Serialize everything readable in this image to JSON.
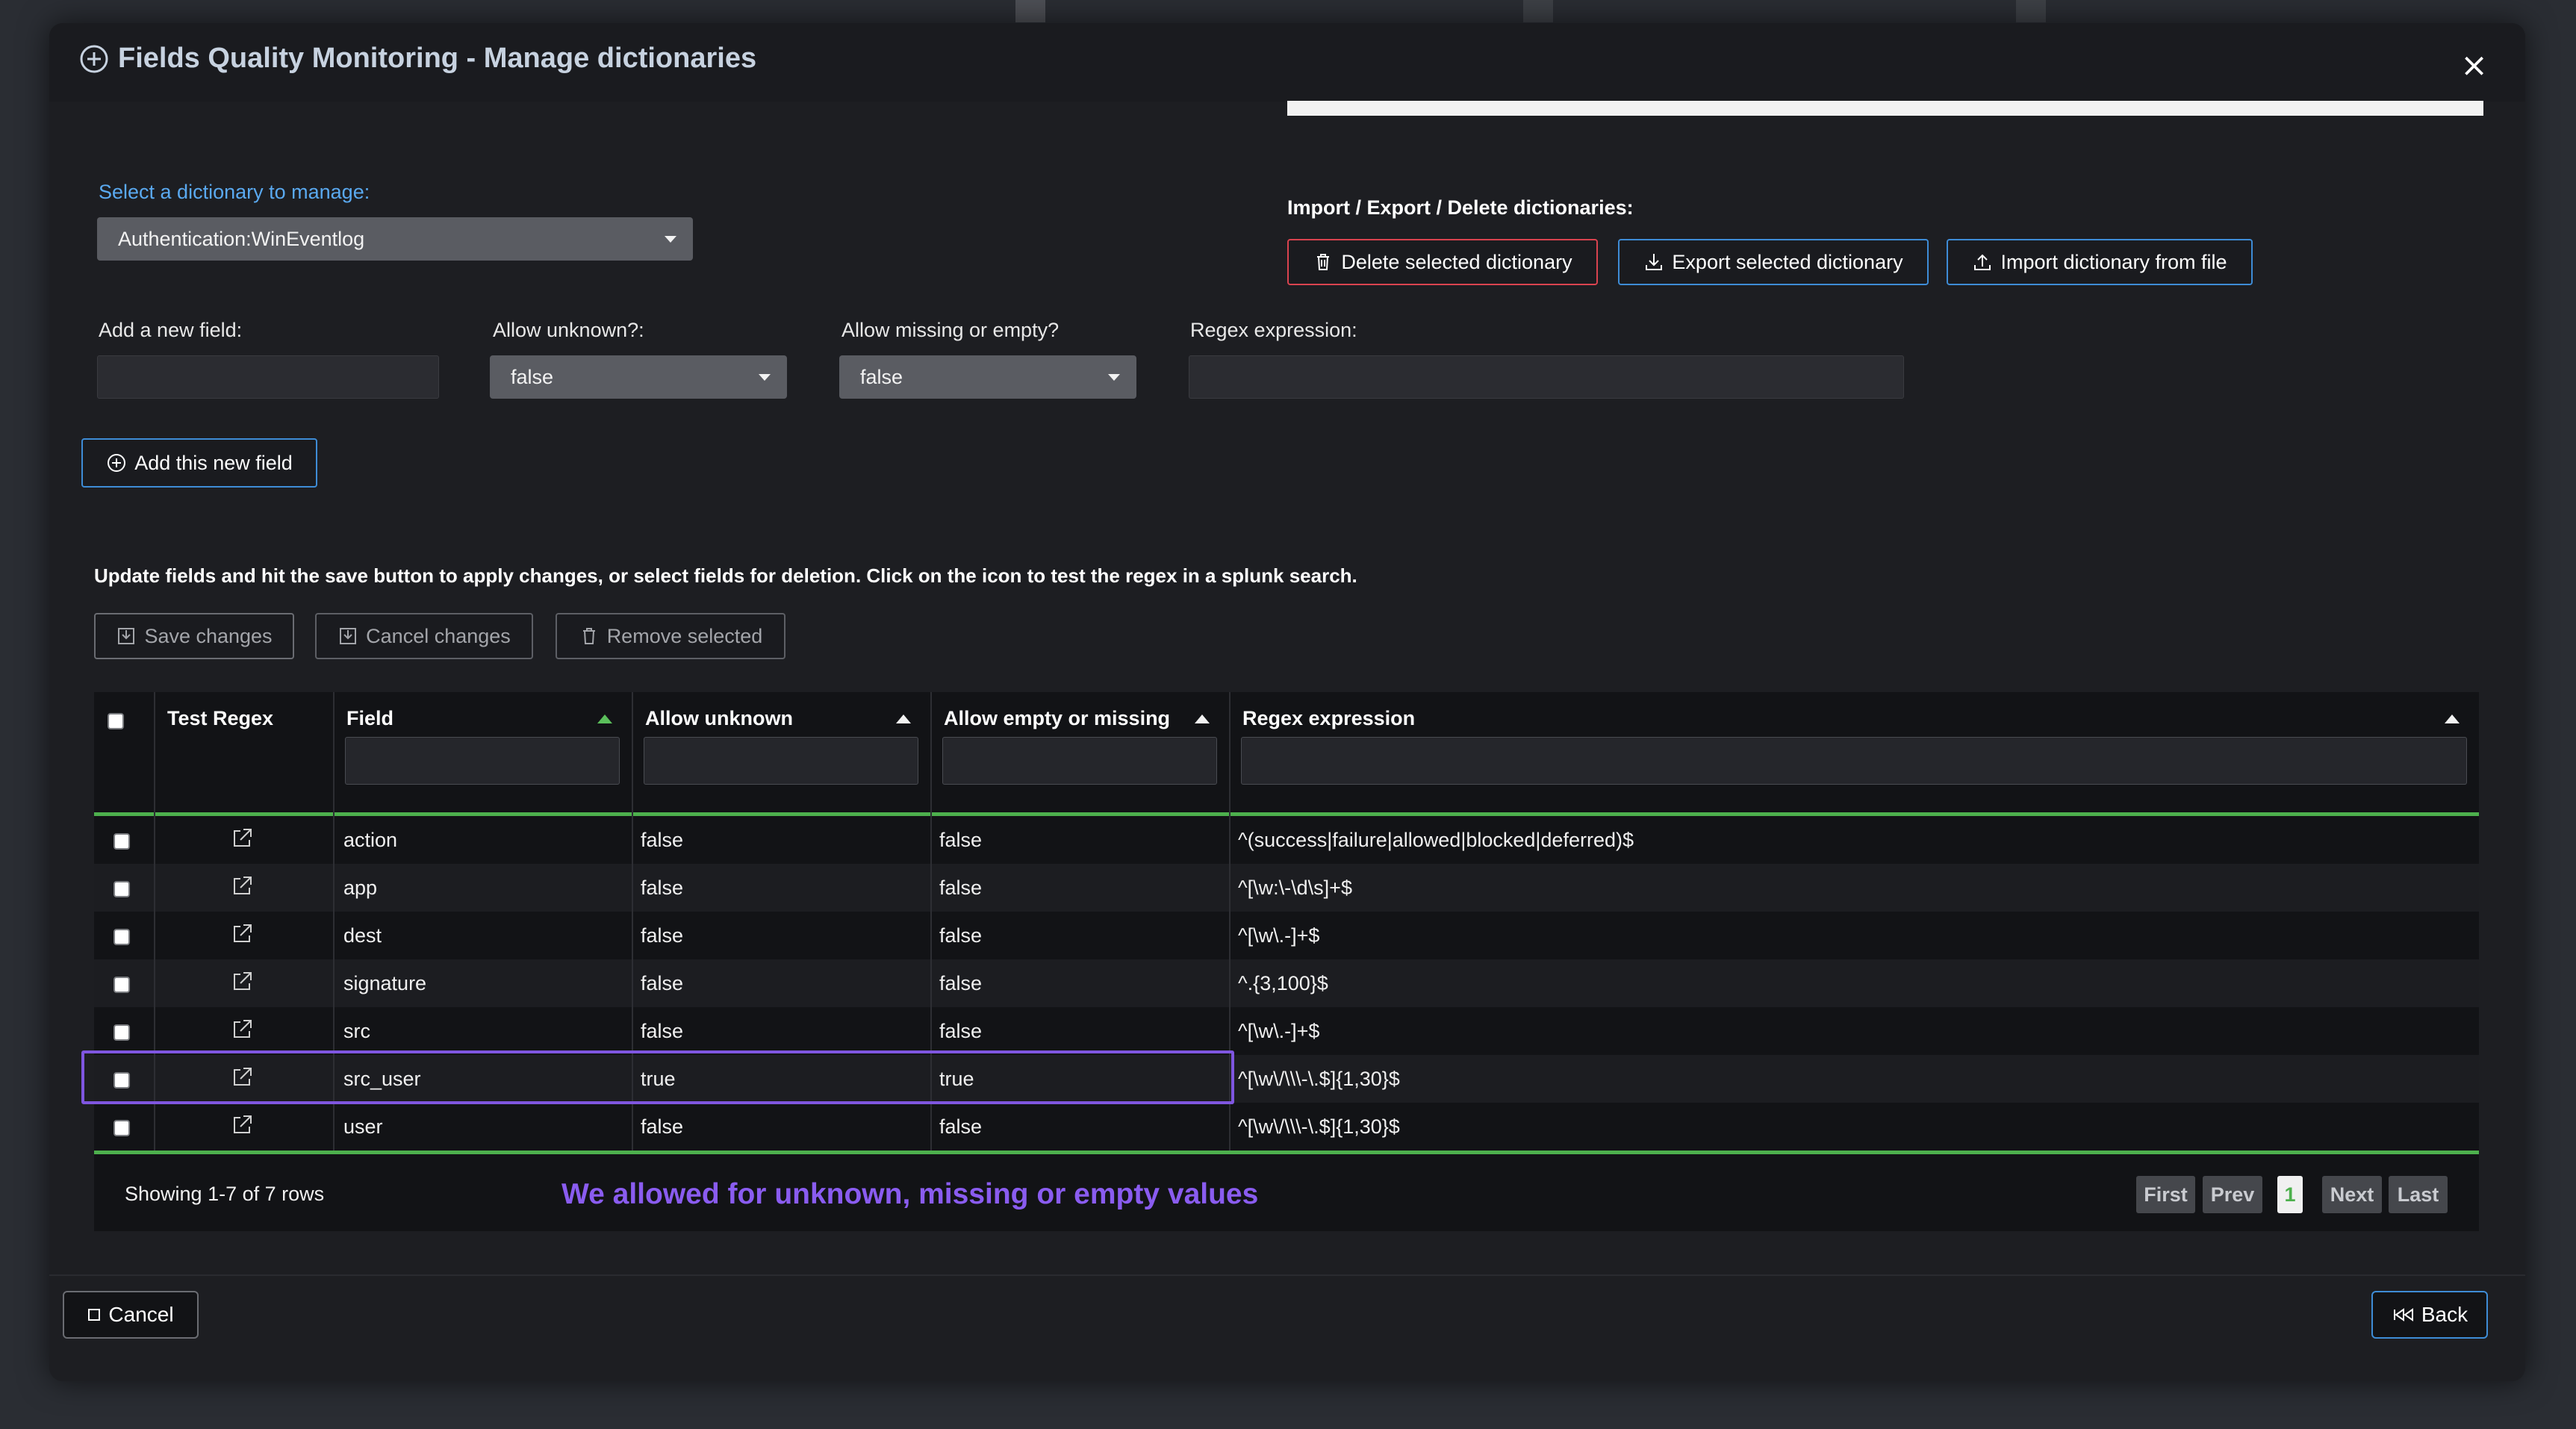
{
  "modal": {
    "title": "Fields Quality Monitoring - Manage dictionaries",
    "close_label": "×"
  },
  "dictionary_select": {
    "label": "Select a dictionary to manage:",
    "value": "Authentication:WinEventlog"
  },
  "import_export": {
    "label": "Import / Export / Delete dictionaries:",
    "delete_label": "Delete selected dictionary",
    "export_label": "Export selected dictionary",
    "import_label": "Import dictionary from file"
  },
  "new_field_form": {
    "field_label": "Add a new field:",
    "field_value": "",
    "allow_unknown_label": "Allow unknown?:",
    "allow_unknown_value": "false",
    "allow_missing_label": "Allow missing or empty?",
    "allow_missing_value": "false",
    "regex_label": "Regex expression:",
    "regex_value": "",
    "add_button_label": "Add this new field"
  },
  "instructions": "Update fields and hit the save button to apply changes, or select fields for deletion. Click on the icon to test the regex in a splunk search.",
  "table_actions": {
    "save_label": "Save changes",
    "cancel_label": "Cancel changes",
    "remove_label": "Remove selected"
  },
  "table": {
    "columns": [
      "Test Regex",
      "Field",
      "Allow unknown",
      "Allow empty or missing",
      "Regex expression"
    ],
    "rows": [
      {
        "field": "action",
        "allow_unknown": "false",
        "allow_empty": "false",
        "regex": "^(success|failure|allowed|blocked|deferred)$"
      },
      {
        "field": "app",
        "allow_unknown": "false",
        "allow_empty": "false",
        "regex": "^[\\w:\\-\\d\\s]+$"
      },
      {
        "field": "dest",
        "allow_unknown": "false",
        "allow_empty": "false",
        "regex": "^[\\w\\.-]+$"
      },
      {
        "field": "signature",
        "allow_unknown": "false",
        "allow_empty": "false",
        "regex": "^.{3,100}$"
      },
      {
        "field": "src",
        "allow_unknown": "false",
        "allow_empty": "false",
        "regex": "^[\\w\\.-]+$"
      },
      {
        "field": "src_user",
        "allow_unknown": "true",
        "allow_empty": "true",
        "regex": "^[\\w\\/\\\\\\-\\.$]{1,30}$"
      },
      {
        "field": "user",
        "allow_unknown": "false",
        "allow_empty": "false",
        "regex": "^[\\w\\/\\\\\\-\\.$]{1,30}$"
      }
    ],
    "summary": "Showing 1-7 of 7 rows",
    "annotation": "We allowed for unknown, missing or empty values",
    "pager": {
      "first": "First",
      "prev": "Prev",
      "current": "1",
      "next": "Next",
      "last": "Last"
    }
  },
  "footer": {
    "cancel_label": "Cancel",
    "back_label": "Back"
  },
  "colors": {
    "accent_blue": "#3e8cd6",
    "danger_red": "#d9434f",
    "sort_green": "#4db04d",
    "annotation_purple": "#8a5cf0"
  }
}
